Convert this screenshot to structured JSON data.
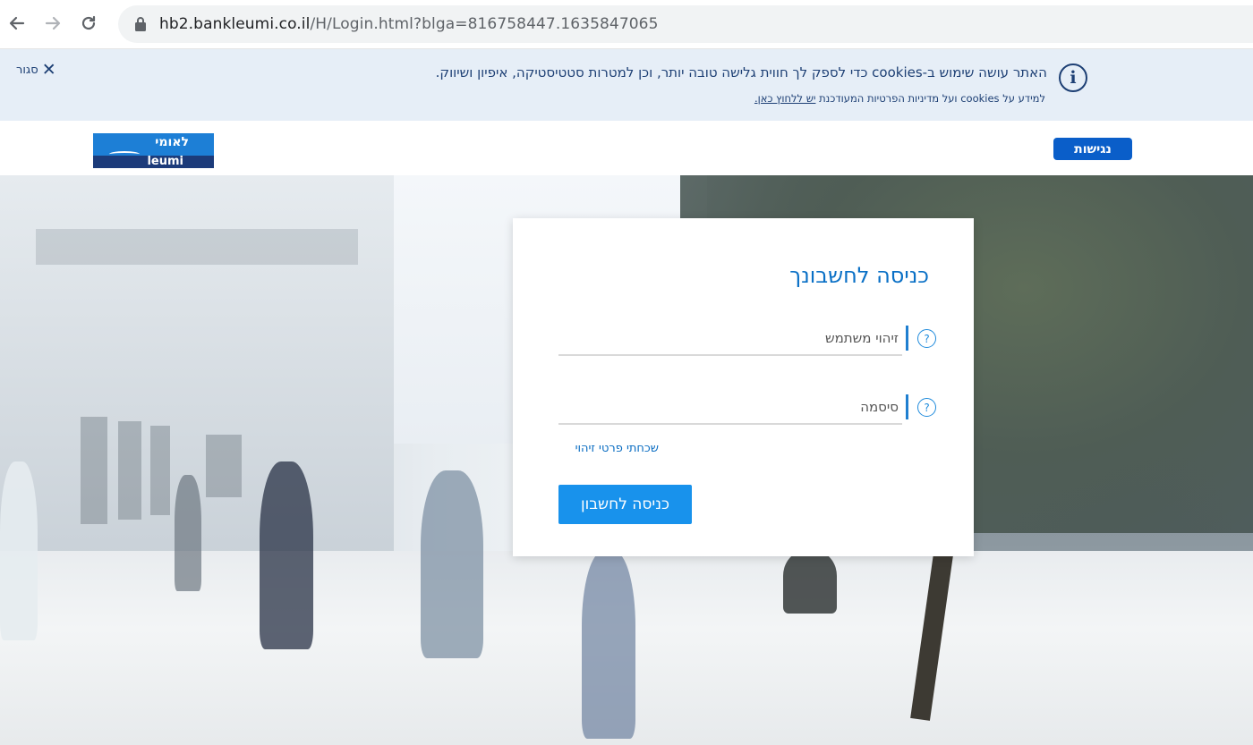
{
  "browser": {
    "url_host": "hb2.bankleumi.co.il",
    "url_rest": "/H/Login.html?blga=816758447.1635847065",
    "icons": [
      "back-arrow-icon",
      "forward-arrow-icon",
      "reload-icon",
      "lock-icon"
    ]
  },
  "cookie_banner": {
    "message": "האתר עושה שימוש ב-cookies כדי לספק לך חווית גלישה טובה יותר, וכן למטרות סטטיסטיקה, איפיון ושיווק.",
    "sub_prefix": "למידע על cookies ועל מדיניות הפרטיות המעודכנת ",
    "sub_link": "יש ללחוץ כאן.",
    "close_label": "סגור",
    "close_symbol": "✕",
    "info_symbol": "i"
  },
  "header": {
    "logo_hebrew": "לאומי",
    "logo_english": "leumi",
    "accessibility_label": "נגישות",
    "brand_color": "#0a5ec9"
  },
  "login": {
    "title": "כניסה לחשבונך",
    "username_placeholder": "זיהוי משתמש",
    "password_placeholder": "סיסמה",
    "help_symbol": "?",
    "forgot_link": "שכחתי פרטי זיהוי",
    "submit_label": "כניסה לחשבון",
    "accent_color": "#1892ec"
  }
}
